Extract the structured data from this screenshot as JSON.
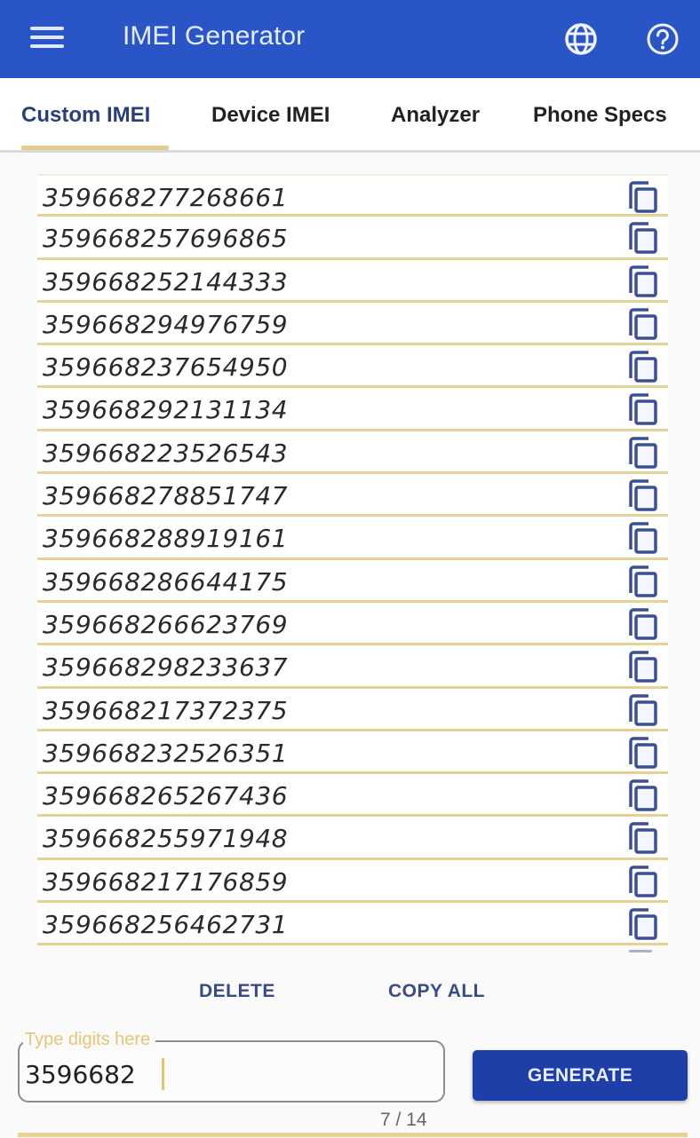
{
  "appbar": {
    "title": "IMEI Generator",
    "menu_icon": "hamburger-menu-icon",
    "language_icon": "globe-icon",
    "help_icon": "help-circle-icon",
    "background": "#2a55c6"
  },
  "tabs": [
    {
      "label": "Custom IMEI",
      "active": true
    },
    {
      "label": "Device IMEI",
      "active": false
    },
    {
      "label": "Analyzer",
      "active": false
    },
    {
      "label": "Phone Specs",
      "active": false
    }
  ],
  "imei_list": [
    "359668277268661",
    "359668257696865",
    "359668252144333",
    "359668294976759",
    "359668237654950",
    "359668292131134",
    "359668223526543",
    "359668278851747",
    "359668288919161",
    "359668286644175",
    "359668266623769",
    "359668298233637",
    "359668217372375",
    "359668232526351",
    "359668265267436",
    "359668255971948",
    "359668217176859",
    "359668256462731"
  ],
  "row_icon": "copy-icon",
  "actions": {
    "delete_label": "DELETE",
    "copy_all_label": "COPY ALL"
  },
  "input": {
    "label": "Type digits here",
    "value": "3596682",
    "counter": "7 / 14"
  },
  "generate_label": "GENERATE",
  "colors": {
    "accent": "#e6d296",
    "primary": "#1f3fa8",
    "label_accent": "#e6c574"
  }
}
